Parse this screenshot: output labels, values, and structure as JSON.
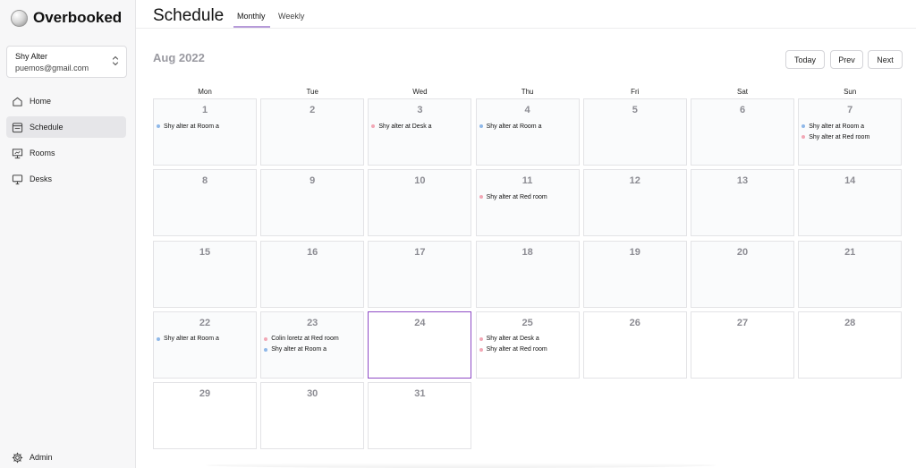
{
  "app": {
    "name": "Overbooked"
  },
  "user": {
    "name": "Shy Alter",
    "email": "puemos@gmail.com"
  },
  "nav": {
    "items": [
      {
        "label": "Home",
        "icon": "home-icon",
        "active": false
      },
      {
        "label": "Schedule",
        "icon": "calendar-icon",
        "active": true
      },
      {
        "label": "Rooms",
        "icon": "presentation-board-icon",
        "active": false
      },
      {
        "label": "Desks",
        "icon": "monitor-icon",
        "active": false
      }
    ],
    "admin": {
      "label": "Admin",
      "icon": "gear-icon"
    }
  },
  "header": {
    "title": "Schedule",
    "tabs": [
      {
        "label": "Monthly",
        "active": true
      },
      {
        "label": "Weekly",
        "active": false
      }
    ]
  },
  "calendar": {
    "month_label": "Aug 2022",
    "buttons": {
      "today": "Today",
      "prev": "Prev",
      "next": "Next"
    },
    "weekdays": [
      "Mon",
      "Tue",
      "Wed",
      "Thu",
      "Fri",
      "Sat",
      "Sun"
    ],
    "today": "24",
    "colors": {
      "blue": "#8fb8e8",
      "pink": "#f2a7b5",
      "today_border": "#8f4bc6"
    },
    "weeks": [
      [
        {
          "day": "1",
          "events": [
            {
              "text": "Shy alter at Room a",
              "color": "blue"
            }
          ]
        },
        {
          "day": "2",
          "events": []
        },
        {
          "day": "3",
          "events": [
            {
              "text": "Shy alter at Desk a",
              "color": "pink"
            }
          ]
        },
        {
          "day": "4",
          "events": [
            {
              "text": "Shy alter at Room a",
              "color": "blue"
            }
          ]
        },
        {
          "day": "5",
          "events": []
        },
        {
          "day": "6",
          "events": []
        },
        {
          "day": "7",
          "events": [
            {
              "text": "Shy alter at Room a",
              "color": "blue"
            },
            {
              "text": "Shy alter at Red room",
              "color": "pink"
            }
          ]
        }
      ],
      [
        {
          "day": "8",
          "events": []
        },
        {
          "day": "9",
          "events": []
        },
        {
          "day": "10",
          "events": []
        },
        {
          "day": "11",
          "events": [
            {
              "text": "Shy alter at Red room",
              "color": "pink"
            }
          ]
        },
        {
          "day": "12",
          "events": []
        },
        {
          "day": "13",
          "events": []
        },
        {
          "day": "14",
          "events": []
        }
      ],
      [
        {
          "day": "15",
          "events": []
        },
        {
          "day": "16",
          "events": []
        },
        {
          "day": "17",
          "events": []
        },
        {
          "day": "18",
          "events": []
        },
        {
          "day": "19",
          "events": []
        },
        {
          "day": "20",
          "events": []
        },
        {
          "day": "21",
          "events": []
        }
      ],
      [
        {
          "day": "22",
          "events": [
            {
              "text": "Shy alter at Room a",
              "color": "blue"
            }
          ]
        },
        {
          "day": "23",
          "events": [
            {
              "text": "Colin loretz at Red room",
              "color": "pink"
            },
            {
              "text": "Shy alter at Room a",
              "color": "blue"
            }
          ]
        },
        {
          "day": "24",
          "events": []
        },
        {
          "day": "25",
          "events": [
            {
              "text": "Shy alter at Desk a",
              "color": "pink"
            },
            {
              "text": "Shy alter at Red room",
              "color": "pink"
            }
          ]
        },
        {
          "day": "26",
          "events": []
        },
        {
          "day": "27",
          "events": []
        },
        {
          "day": "28",
          "events": []
        }
      ],
      [
        {
          "day": "29",
          "events": []
        },
        {
          "day": "30",
          "events": []
        },
        {
          "day": "31",
          "events": []
        }
      ]
    ]
  }
}
